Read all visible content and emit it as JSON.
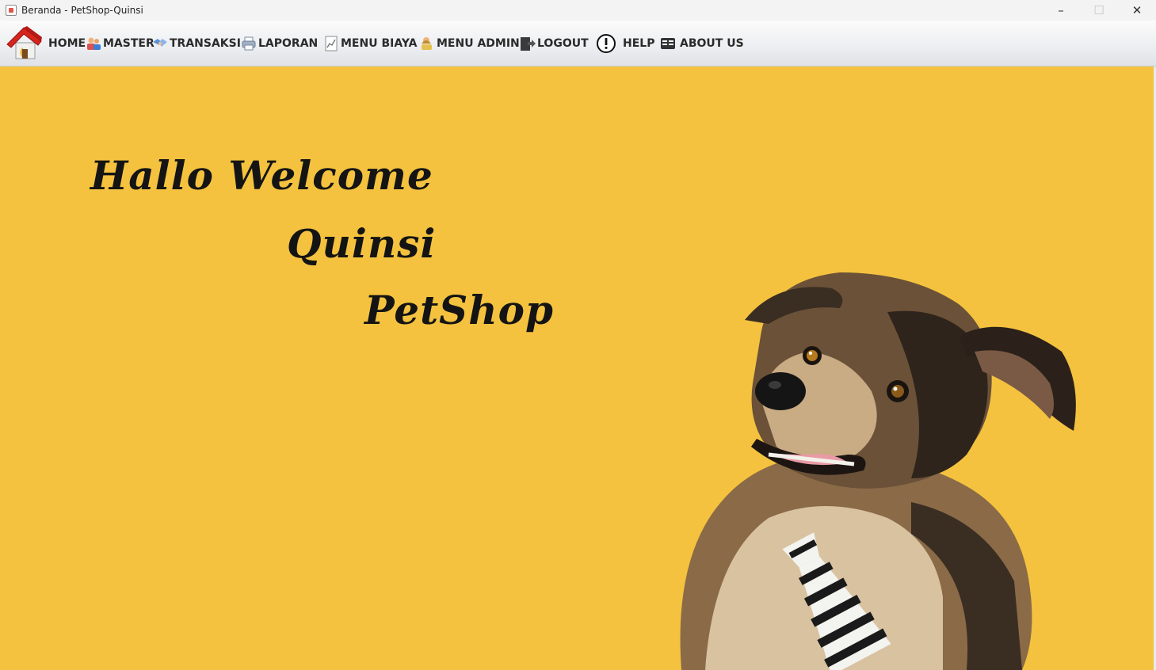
{
  "window": {
    "title": "Beranda - PetShop-Quinsi",
    "minimize_glyph": "–",
    "maximize_glyph": "☐",
    "close_glyph": "✕"
  },
  "menu": {
    "logo_icon": "house-red-roof-icon",
    "items": [
      {
        "label": "HOME",
        "icon": "none"
      },
      {
        "label": "MASTER",
        "icon": "people-icon"
      },
      {
        "label": "TRANSAKSI",
        "icon": "handshake-icon"
      },
      {
        "label": "LAPORAN",
        "icon": "printer-icon"
      },
      {
        "label": "MENU BIAYA",
        "icon": "chart-icon"
      },
      {
        "label": "MENU ADMIN",
        "icon": "admin-user-icon"
      },
      {
        "label": "LOGOUT",
        "icon": "logout-door-icon"
      },
      {
        "label": "HELP",
        "icon": "exclamation-circle-icon"
      },
      {
        "label": "ABOUT US",
        "icon": "id-card-icon"
      }
    ]
  },
  "welcome": {
    "line1": "Hallo Welcome",
    "line2": "Quinsi",
    "line3": "PetShop"
  },
  "colors": {
    "background": "#f4c23e",
    "text": "#141414",
    "menubar": "#eceef1"
  },
  "image": {
    "subject": "dog-with-striped-tie-image"
  }
}
